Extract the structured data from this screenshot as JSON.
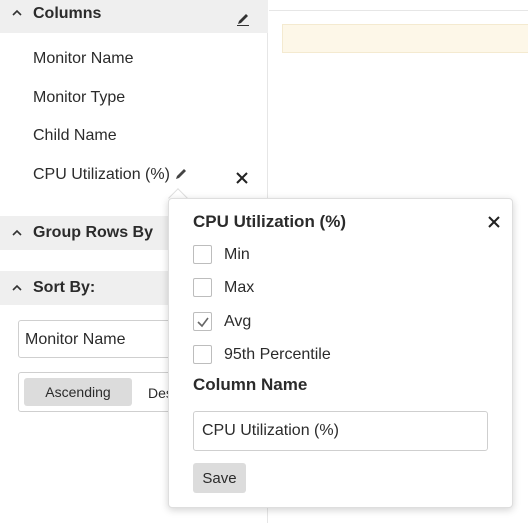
{
  "columns_section": {
    "title": "Columns",
    "items": [
      "Monitor Name",
      "Monitor Type",
      "Child Name",
      "CPU Utilization (%)"
    ]
  },
  "group_section": {
    "title": "Group Rows By"
  },
  "sort_section": {
    "title": "Sort By:",
    "selected": "Monitor Name",
    "order_options": [
      "Ascending",
      "Des"
    ],
    "order_selected": "Ascending"
  },
  "popup": {
    "title": "CPU Utilization (%)",
    "options": [
      {
        "label": "Min",
        "checked": false
      },
      {
        "label": "Max",
        "checked": false
      },
      {
        "label": "Avg",
        "checked": true
      },
      {
        "label": "95th Percentile",
        "checked": false
      }
    ],
    "column_name_label": "Column Name",
    "column_name_value": "CPU Utilization (%)",
    "save_label": "Save"
  },
  "icons": {
    "collapse": "chevron-up-icon",
    "edit": "pencil-icon",
    "remove": "close-icon",
    "check": "checkmark-icon"
  },
  "colors": {
    "section_bg": "#efefef",
    "notice_bg": "#fdf7e8",
    "button_bg": "#dcdcdc"
  }
}
